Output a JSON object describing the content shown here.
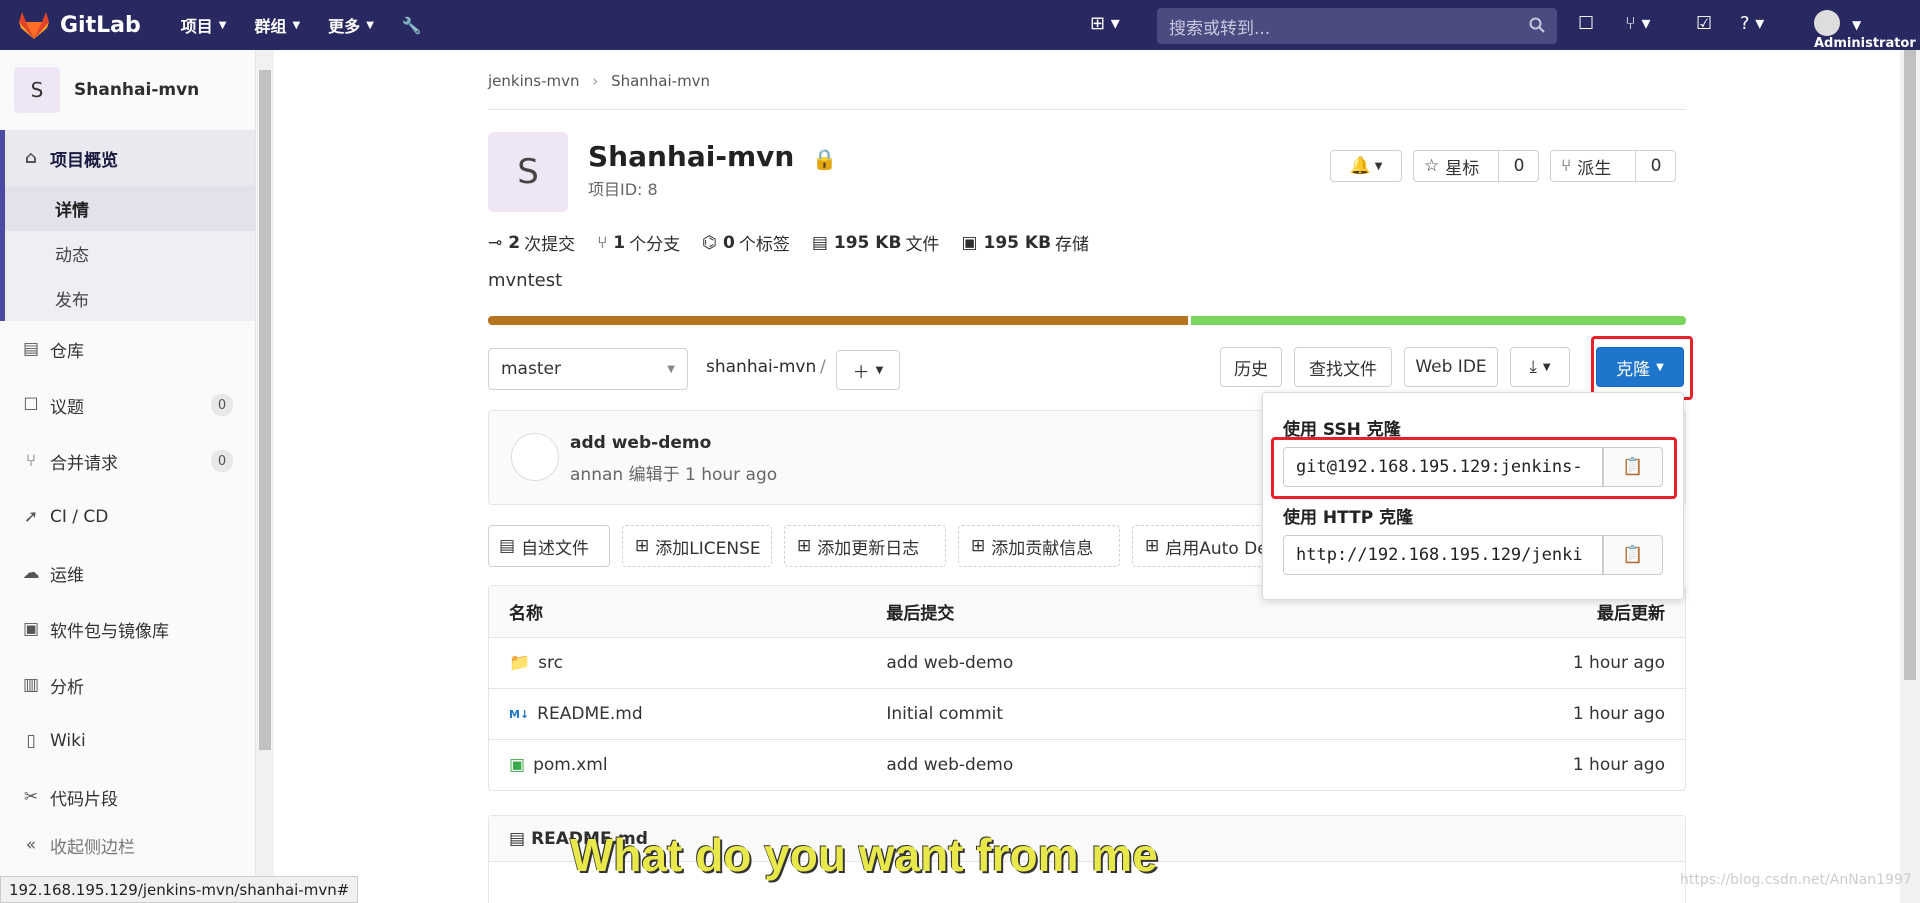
{
  "topbar": {
    "logo": "GitLab",
    "nav": [
      {
        "label": "项目"
      },
      {
        "label": "群组"
      },
      {
        "label": "更多"
      }
    ],
    "search_placeholder": "搜索或转到...",
    "user": "Administrator"
  },
  "sidebar": {
    "avatar_letter": "S",
    "project_name": "Shanhai-mvn",
    "overview": "项目概览",
    "overview_sub": [
      "详情",
      "动态",
      "发布"
    ],
    "items": [
      {
        "label": "仓库",
        "icon": "repo-icon"
      },
      {
        "label": "议题",
        "icon": "issues-icon",
        "badge": "0"
      },
      {
        "label": "合并请求",
        "icon": "merge-request-icon",
        "badge": "0"
      },
      {
        "label": "CI / CD",
        "icon": "rocket-icon"
      },
      {
        "label": "运维",
        "icon": "cloud-icon"
      },
      {
        "label": "软件包与镜像库",
        "icon": "package-icon"
      },
      {
        "label": "分析",
        "icon": "chart-icon"
      },
      {
        "label": "Wiki",
        "icon": "book-icon"
      },
      {
        "label": "代码片段",
        "icon": "snippet-icon"
      }
    ],
    "collapse": "收起侧边栏"
  },
  "breadcrumb": [
    "jenkins-mvn",
    "Shanhai-mvn"
  ],
  "project": {
    "avatar_letter": "S",
    "title": "Shanhai-mvn",
    "id_text": "项目ID: 8",
    "star_label": "星标",
    "star_count": "0",
    "fork_label": "派生",
    "fork_count": "0",
    "stats": {
      "commits_num": "2",
      "commits_label": "次提交",
      "branches_num": "1",
      "branches_label": "个分支",
      "tags_num": "0",
      "tags_label": "个标签",
      "files_num": "195 KB",
      "files_label": "文件",
      "storage_num": "195 KB",
      "storage_label": "存储"
    },
    "description": "mvntest",
    "lang_bar": [
      {
        "color": "#b5731f",
        "pct": 58.6
      },
      {
        "color": "#7ad55c",
        "pct": 41.4
      }
    ]
  },
  "toolbar": {
    "branch": "master",
    "path": "shanhai-mvn",
    "separator": "/",
    "history": "历史",
    "find_file": "查找文件",
    "web_ide": "Web IDE",
    "clone": "克隆"
  },
  "commit": {
    "title": "add web-demo",
    "author": "annan",
    "action": "编辑于",
    "time": "1 hour ago"
  },
  "actions": [
    "自述文件",
    "添加LICENSE",
    "添加更新日志",
    "添加贡献信息",
    "启用Auto Dev"
  ],
  "table": {
    "headers": [
      "名称",
      "最后提交",
      "最后更新"
    ],
    "rows": [
      {
        "name": "src",
        "icon": "folder-icon",
        "commit": "add web-demo",
        "updated": "1 hour ago"
      },
      {
        "name": "README.md",
        "icon": "markdown-icon",
        "commit": "Initial commit",
        "updated": "1 hour ago"
      },
      {
        "name": "pom.xml",
        "icon": "file-xml-icon",
        "commit": "add web-demo",
        "updated": "1 hour ago"
      }
    ]
  },
  "readme": {
    "title": "README.md"
  },
  "clone_dropdown": {
    "ssh_label": "使用 SSH 克隆",
    "ssh_url": "git@192.168.195.129:jenkins-",
    "http_label": "使用 HTTP 克隆",
    "http_url": "http://192.168.195.129/jenki"
  },
  "status_url": "192.168.195.129/jenkins-mvn/shanhai-mvn#",
  "subtitle": "What do you want from me",
  "watermark": "https://blog.csdn.net/AnNan1997"
}
